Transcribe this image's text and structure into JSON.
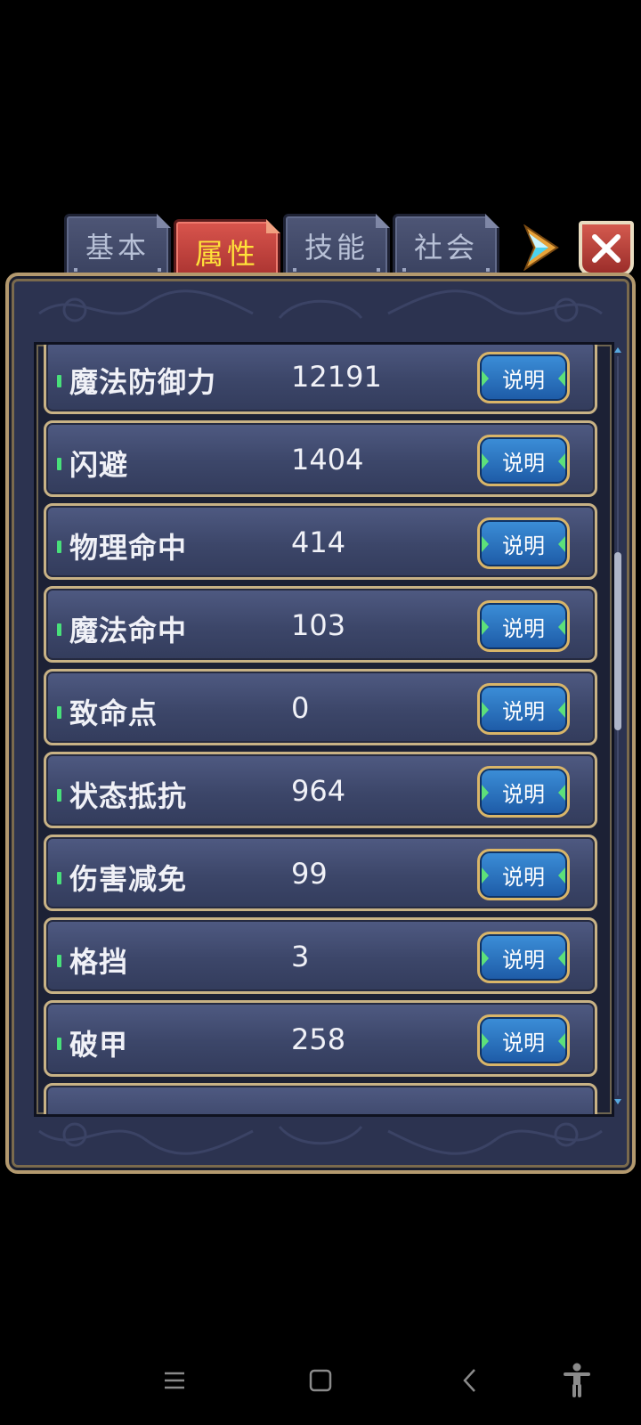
{
  "tabs": [
    {
      "label": "基本",
      "active": false
    },
    {
      "label": "属性",
      "active": true
    },
    {
      "label": "技能",
      "active": false
    },
    {
      "label": "社会",
      "active": false
    }
  ],
  "stats": [
    {
      "name": "魔法防御力",
      "value": "12191",
      "button": "说明"
    },
    {
      "name": "闪避",
      "value": "1404",
      "button": "说明"
    },
    {
      "name": "物理命中",
      "value": "414",
      "button": "说明"
    },
    {
      "name": "魔法命中",
      "value": "103",
      "button": "说明"
    },
    {
      "name": "致命点",
      "value": "0",
      "button": "说明"
    },
    {
      "name": "状态抵抗",
      "value": "964",
      "button": "说明"
    },
    {
      "name": "伤害减免",
      "value": "99",
      "button": "说明"
    },
    {
      "name": "格挡",
      "value": "3",
      "button": "说明"
    },
    {
      "name": "破甲",
      "value": "258",
      "button": "说明"
    }
  ],
  "colors": {
    "active_tab_text": "#ffe23a",
    "panel": "#2c3350",
    "gold_border": "#c8b285",
    "button_blue": "#2f78c8",
    "indicator_green": "#48e07a"
  },
  "icons": [
    "next-arrow-icon",
    "close-icon",
    "menu-icon",
    "home-square-icon",
    "back-chevron-icon",
    "accessibility-icon"
  ]
}
